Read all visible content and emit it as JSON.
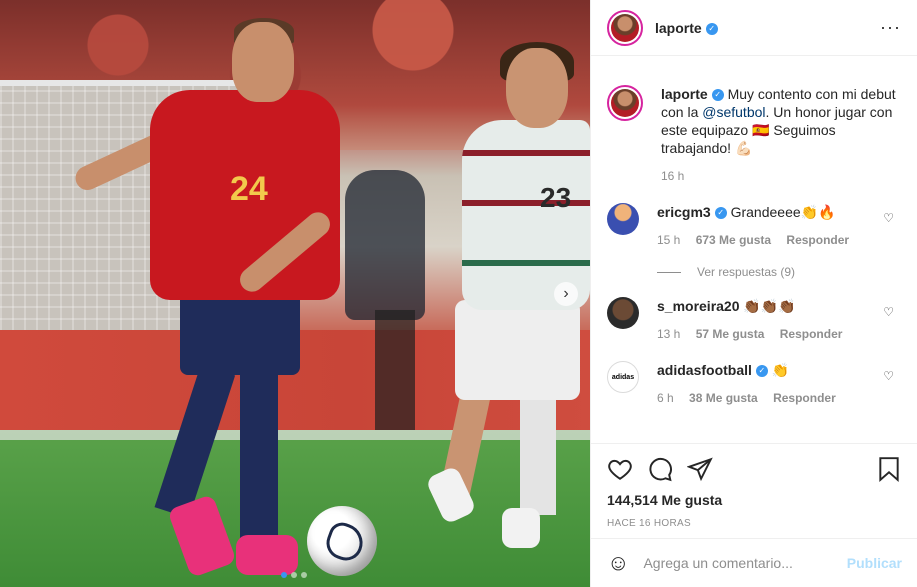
{
  "post": {
    "author": "laporte",
    "verified": true,
    "caption": "Muy contento con mi debut con la",
    "mention": "@sefutbol",
    "caption_rest": ". Un honor jugar con este equipazo 🇪🇸 Seguimos trabajando! 💪🏻",
    "time": "16 h",
    "player_numbers": {
      "spain": "24",
      "portugal": "23"
    }
  },
  "header": {
    "more_label": "···"
  },
  "comments": [
    {
      "user": "ericgm3",
      "verified": true,
      "text": "Grandeeee👏🔥",
      "time": "15 h",
      "likes": "673 Me gusta",
      "reply": "Responder"
    },
    {
      "user": "s_moreira20",
      "verified": false,
      "text": "👏🏾👏🏾👏🏾",
      "time": "13 h",
      "likes": "57 Me gusta",
      "reply": "Responder"
    },
    {
      "user": "adidasfootball",
      "verified": true,
      "text": "👏",
      "time": "6 h",
      "likes": "38 Me gusta",
      "reply": "Responder"
    }
  ],
  "view_replies": "Ver respuestas (9)",
  "actions": {
    "likes": "144,514 Me gusta",
    "date": "HACE 16 HORAS"
  },
  "comment_box": {
    "placeholder": "Agrega un comentario...",
    "publish": "Publicar"
  },
  "adidas_logo_text": "adidas",
  "colors": {
    "verified": "#3897f0",
    "publish_disabled": "#b2dffc",
    "link": "#00376b"
  }
}
